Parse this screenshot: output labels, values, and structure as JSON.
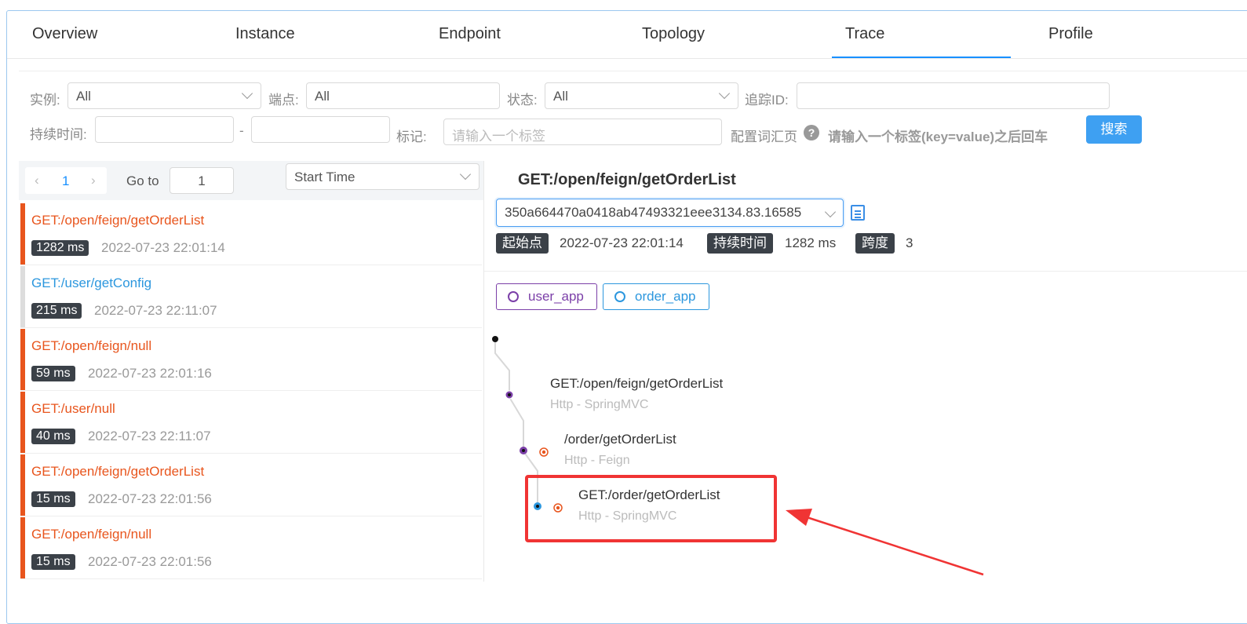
{
  "tabs": [
    "Overview",
    "Instance",
    "Endpoint",
    "Topology",
    "Trace",
    "Profile"
  ],
  "active_tab": "Trace",
  "filters": {
    "instance_label": "实例:",
    "instance_value": "All",
    "endpoint_label": "端点:",
    "endpoint_value": "All",
    "status_label": "状态:",
    "status_value": "All",
    "traceid_label": "追踪ID:",
    "traceid_value": "",
    "duration_label": "持续时间:",
    "duration_sep": "-",
    "tag_label": "标记:",
    "tag_placeholder": "请输入一个标签",
    "config_label": "配置词汇页",
    "help_icon": "?",
    "hint": "请输入一个标签(key=value)之后回车",
    "search_button": "搜索"
  },
  "pager": {
    "page": "1",
    "goto_label": "Go to",
    "goto_value": "1",
    "sort_value": "Start Time"
  },
  "traces": [
    {
      "name": "GET:/open/feign/getOrderList",
      "duration": "1282 ms",
      "time": "2022-07-23 22:01:14",
      "status": "error"
    },
    {
      "name": "GET:/user/getConfig",
      "duration": "215 ms",
      "time": "2022-07-23 22:11:07",
      "status": "ok"
    },
    {
      "name": "GET:/open/feign/null",
      "duration": "59 ms",
      "time": "2022-07-23 22:01:16",
      "status": "error"
    },
    {
      "name": "GET:/user/null",
      "duration": "40 ms",
      "time": "2022-07-23 22:11:07",
      "status": "error"
    },
    {
      "name": "GET:/open/feign/getOrderList",
      "duration": "15 ms",
      "time": "2022-07-23 22:01:56",
      "status": "error"
    },
    {
      "name": "GET:/open/feign/null",
      "duration": "15 ms",
      "time": "2022-07-23 22:01:56",
      "status": "error"
    }
  ],
  "detail": {
    "title": "GET:/open/feign/getOrderList",
    "trace_id": "350a664470a0418ab47493321eee3134.83.16585",
    "start_label": "起始点",
    "start_value": "2022-07-23 22:01:14",
    "duration_label": "持续时间",
    "duration_value": "1282 ms",
    "span_label": "跨度",
    "span_value": "3",
    "services": [
      {
        "name": "user_app",
        "color": "#7b3fa8"
      },
      {
        "name": "order_app",
        "color": "#2c97de"
      }
    ],
    "spans": [
      {
        "name": "GET:/open/feign/getOrderList",
        "sub": "Http - SpringMVC"
      },
      {
        "name": "/order/getOrderList",
        "sub": "Http - Feign"
      },
      {
        "name": "GET:/order/getOrderList",
        "sub": "Http - SpringMVC"
      }
    ]
  },
  "colors": {
    "error": "#e8551d",
    "ok": "#2c97de",
    "accent": "#1890ff",
    "highlight": "#f03434"
  }
}
